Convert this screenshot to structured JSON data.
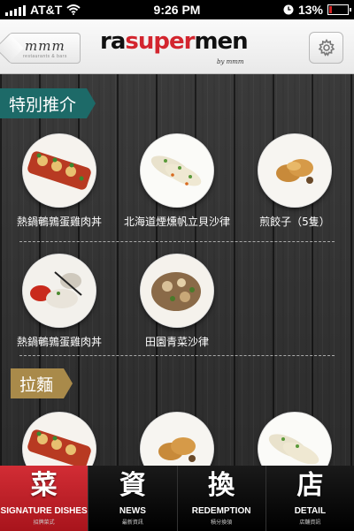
{
  "status_bar": {
    "carrier": "AT&T",
    "time": "9:26 PM",
    "battery": "13%",
    "battery_level": 0.13
  },
  "nav": {
    "back_logo": "mmm",
    "back_sub": "restaurants & bars",
    "brand_left": "ra",
    "brand_mid": "super",
    "brand_right": "men",
    "brand_sub": "by mmm",
    "settings_icon": "gear-icon"
  },
  "sections": {
    "featured": {
      "title": "特別推介",
      "dishes": [
        {
          "name": "熱鍋鵪鶉蛋雞肉丼"
        },
        {
          "name": "北海道煙燻帆立貝沙律"
        },
        {
          "name": "煎餃子（5隻）"
        },
        {
          "name": "熱鍋鵪鶉蛋雞肉丼"
        },
        {
          "name": "田園青菜沙律"
        }
      ]
    },
    "ramen": {
      "title": "拉麵"
    }
  },
  "tabs": [
    {
      "glyph": "菜",
      "label": "SIGNATURE DISHES",
      "sub": "招牌菜式",
      "active": true
    },
    {
      "glyph": "資",
      "label": "NEWS",
      "sub": "最新資訊",
      "active": false
    },
    {
      "glyph": "換",
      "label": "REDEMPTION",
      "sub": "積分換領",
      "active": false
    },
    {
      "glyph": "店",
      "label": "DETAIL",
      "sub": "店舖資訊",
      "active": false
    }
  ],
  "colors": {
    "brand_red": "#d3252e",
    "section_teal": "#1d6a68",
    "section_gold": "#a98a4a",
    "tab_active": "#c2222a"
  }
}
